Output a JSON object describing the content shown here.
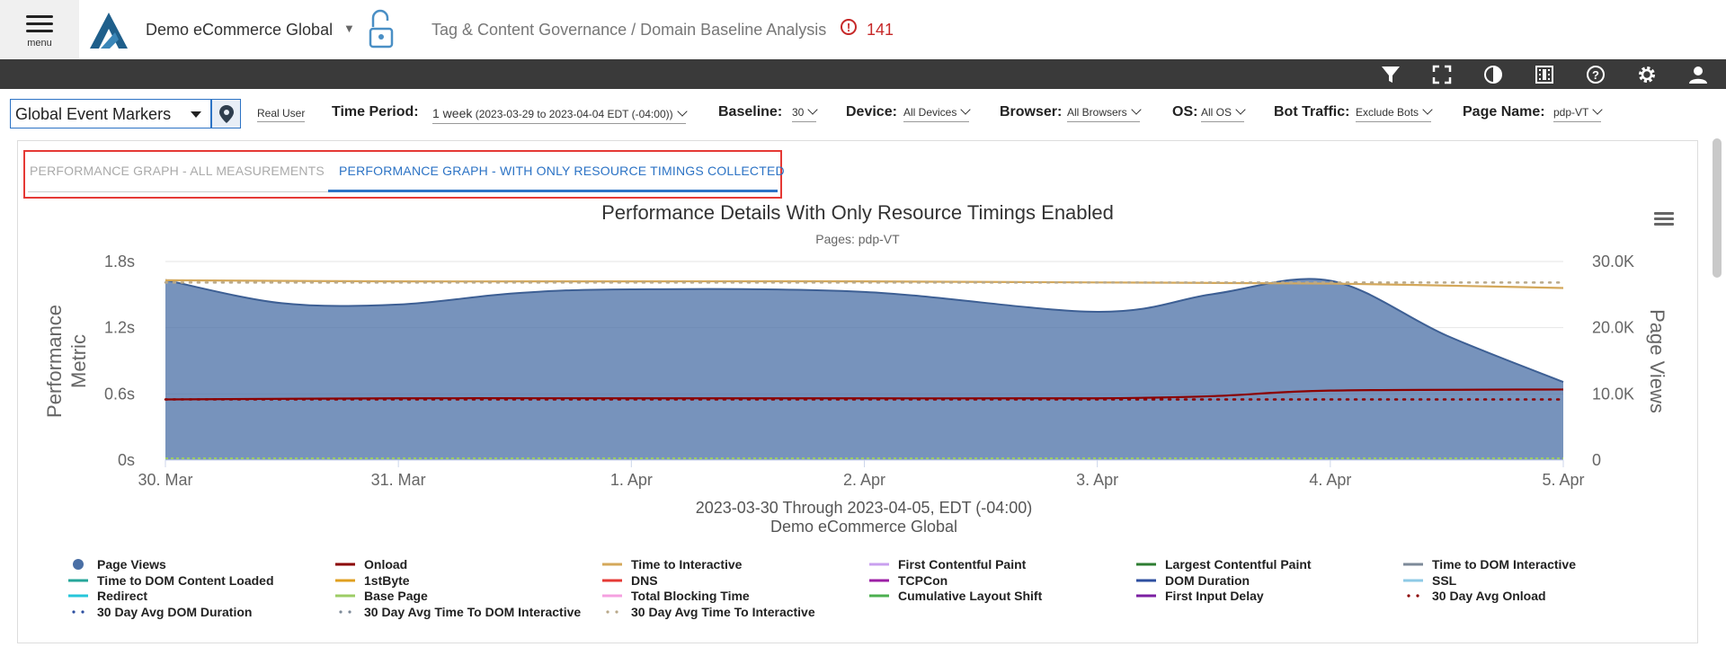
{
  "header": {
    "menu_label": "menu",
    "app_title": "Demo eCommerce Global",
    "breadcrumb": "Tag & Content Governance / Domain Baseline Analysis",
    "alert_count": "141"
  },
  "toolbar_icons": [
    "filter-icon",
    "fullscreen-icon",
    "contrast-icon",
    "film-icon",
    "help-icon",
    "settings-icon",
    "user-icon"
  ],
  "filters": {
    "event_markers": "Global Event Markers",
    "real_user": "Real User",
    "time_period_label": "Time Period:",
    "time_period_value": "1 week",
    "time_period_range": "(2023-03-29 to 2023-04-04 EDT (-04:00))",
    "baseline_label": "Baseline:",
    "baseline_value": "30",
    "device_label": "Device:",
    "device_value": "All Devices",
    "browser_label": "Browser:",
    "browser_value": "All Browsers",
    "os_label": "OS:",
    "os_value": "All OS",
    "bot_label": "Bot Traffic:",
    "bot_value": "Exclude Bots",
    "page_label": "Page Name:",
    "page_value": "pdp-VT"
  },
  "tabs": [
    {
      "label": "PERFORMANCE GRAPH - ALL MEASUREMENTS",
      "active": false
    },
    {
      "label": "PERFORMANCE GRAPH - WITH ONLY RESOURCE TIMINGS COLLECTED",
      "active": true
    }
  ],
  "chart_data": {
    "type": "area",
    "title": "Performance Details With Only Resource Timings Enabled",
    "subtitle": "Pages: pdp-VT",
    "ylabel": "Performance Metric",
    "y2label": "Page Views",
    "xlabel": "2023-03-30 Through 2023-04-05, EDT (-04:00)",
    "xlabel2": "Demo eCommerce Global",
    "categories": [
      "30. Mar",
      "31. Mar",
      "1. Apr",
      "2. Apr",
      "3. Apr",
      "4. Apr",
      "5. Apr"
    ],
    "y_ticks": [
      "0s",
      "0.6s",
      "1.2s",
      "1.8s"
    ],
    "ylim": [
      0,
      1.8
    ],
    "y2_ticks": [
      "0",
      "10.0K",
      "20.0K",
      "30.0K"
    ],
    "y2lim": [
      0,
      30000
    ],
    "series": [
      {
        "name": "Page Views",
        "axis": "y2",
        "type": "area",
        "color": "#4a6fa5",
        "x": [
          0,
          0.5,
          1,
          1.5,
          2,
          3,
          4,
          4.5,
          5,
          5.5,
          6
        ],
        "values": [
          27200,
          23700,
          23500,
          25200,
          25800,
          25400,
          22400,
          25100,
          27100,
          18800,
          11800
        ]
      },
      {
        "name": "Onload",
        "axis": "y",
        "type": "line",
        "color": "#8b0000",
        "x": [
          0,
          1,
          2,
          3,
          4,
          4.5,
          5,
          6
        ],
        "values": [
          0.55,
          0.56,
          0.56,
          0.56,
          0.56,
          0.58,
          0.63,
          0.64
        ]
      },
      {
        "name": "Time to Interactive",
        "axis": "y",
        "type": "line",
        "color": "#d4a85a",
        "x": [
          0,
          1,
          2,
          3,
          4,
          5,
          6
        ],
        "values": [
          1.63,
          1.62,
          1.62,
          1.62,
          1.61,
          1.6,
          1.56
        ]
      },
      {
        "name": "30 Day Avg Onload",
        "axis": "y",
        "type": "dotted",
        "color": "#8b0000",
        "x": [
          0,
          6
        ],
        "values": [
          0.55,
          0.55
        ]
      },
      {
        "name": "30 Day Avg Time To Interactive",
        "axis": "y",
        "type": "dotted",
        "color": "#b9a98a",
        "x": [
          0,
          6
        ],
        "values": [
          1.61,
          1.61
        ]
      }
    ],
    "legend": [
      {
        "name": "Page Views",
        "color": "#4a6fa5",
        "symbol": "dot"
      },
      {
        "name": "Onload",
        "color": "#8b0000",
        "symbol": "line"
      },
      {
        "name": "Time to Interactive",
        "color": "#d4a85a",
        "symbol": "line"
      },
      {
        "name": "First Contentful Paint",
        "color": "#c9a0ef",
        "symbol": "line"
      },
      {
        "name": "Largest Contentful Paint",
        "color": "#2e7d32",
        "symbol": "line"
      },
      {
        "name": "Time to DOM Interactive",
        "color": "#7d8a99",
        "symbol": "line"
      },
      {
        "name": "Time to DOM Content Loaded",
        "color": "#26a69a",
        "symbol": "line"
      },
      {
        "name": "1stByte",
        "color": "#e0a020",
        "symbol": "line"
      },
      {
        "name": "DNS",
        "color": "#e53935",
        "symbol": "line"
      },
      {
        "name": "TCPCon",
        "color": "#9c1fa5",
        "symbol": "line"
      },
      {
        "name": "DOM Duration",
        "color": "#2d4fa0",
        "symbol": "line"
      },
      {
        "name": "SSL",
        "color": "#8ecae6",
        "symbol": "line"
      },
      {
        "name": "Redirect",
        "color": "#26c6da",
        "symbol": "line"
      },
      {
        "name": "Base Page",
        "color": "#9ccc65",
        "symbol": "line"
      },
      {
        "name": "Total Blocking Time",
        "color": "#f5a0e0",
        "symbol": "line"
      },
      {
        "name": "Cumulative Layout Shift",
        "color": "#4caf50",
        "symbol": "line"
      },
      {
        "name": "First Input Delay",
        "color": "#7b1fa2",
        "symbol": "line"
      },
      {
        "name": "30 Day Avg Onload",
        "color": "#8b0000",
        "symbol": "dots"
      },
      {
        "name": "30 Day Avg DOM Duration",
        "color": "#2d4fa0",
        "symbol": "dots"
      },
      {
        "name": "30 Day Avg Time To DOM Interactive",
        "color": "#7d8a99",
        "symbol": "dots"
      },
      {
        "name": "30 Day Avg Time To Interactive",
        "color": "#b9a98a",
        "symbol": "dots"
      }
    ]
  }
}
